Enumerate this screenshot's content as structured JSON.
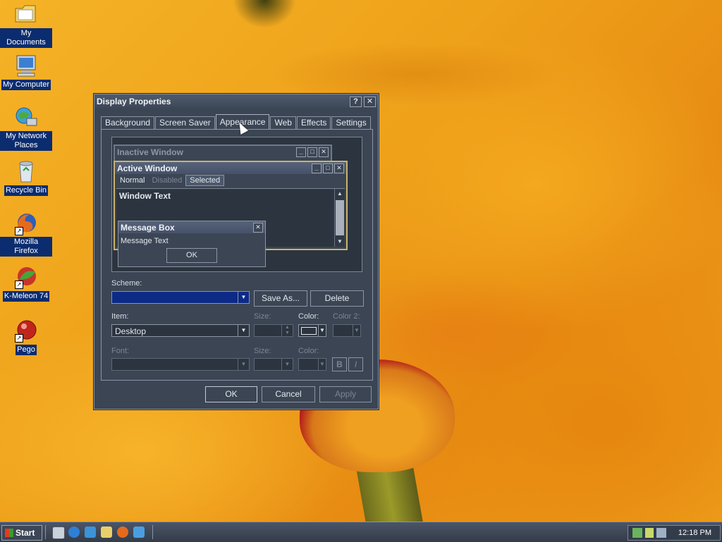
{
  "desktop": {
    "icons": [
      {
        "label": "My Documents"
      },
      {
        "label": "My Computer"
      },
      {
        "label": "My Network Places"
      },
      {
        "label": "Recycle Bin"
      },
      {
        "label": "Mozilla Firefox"
      },
      {
        "label": "K-Meleon 74"
      },
      {
        "label": "Pego"
      }
    ]
  },
  "dialog": {
    "title": "Display Properties",
    "help_glyph": "?",
    "close_glyph": "✕",
    "tabs": [
      "Background",
      "Screen Saver",
      "Appearance",
      "Web",
      "Effects",
      "Settings"
    ],
    "preview": {
      "inactive_title": "Inactive Window",
      "active_title": "Active Window",
      "menu": {
        "normal": "Normal",
        "disabled": "Disabled",
        "selected": "Selected"
      },
      "window_text": "Window Text",
      "message_box_title": "Message Box",
      "message_text": "Message Text",
      "ok": "OK"
    },
    "scheme_label": "Scheme:",
    "scheme_value": "",
    "save_as": "Save As...",
    "delete": "Delete",
    "item_label": "Item:",
    "item_value": "Desktop",
    "size_label": "Size:",
    "color_label": "Color:",
    "color2_label": "Color 2:",
    "font_label": "Font:",
    "font_size_label": "Size:",
    "font_color_label": "Color:",
    "bold": "B",
    "italic": "I",
    "ok": "OK",
    "cancel": "Cancel",
    "apply": "Apply"
  },
  "taskbar": {
    "start": "Start",
    "clock": "12:18 PM"
  },
  "colors": {
    "scheme_selected": "#0d2a86",
    "dialog_bg": "#3b4554"
  }
}
